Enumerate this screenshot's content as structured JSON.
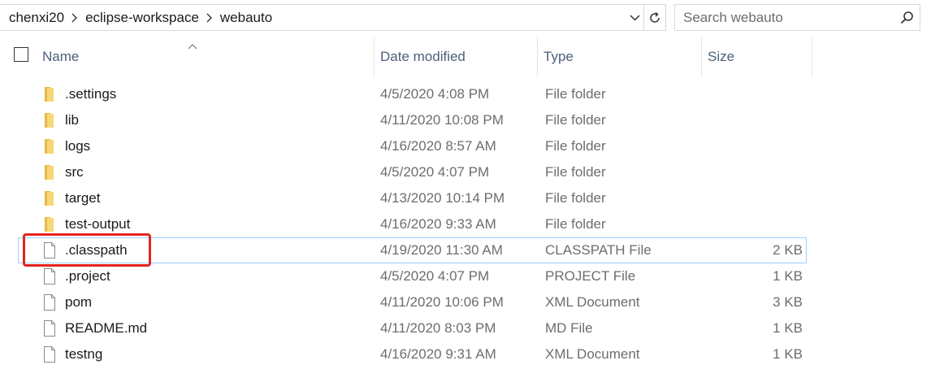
{
  "address": {
    "crumbs": [
      "chenxi20",
      "eclipse-workspace",
      "webauto"
    ]
  },
  "search": {
    "placeholder": "Search webauto"
  },
  "columns": {
    "name": "Name",
    "date": "Date modified",
    "type": "Type",
    "size": "Size"
  },
  "files": [
    {
      "name": ".settings",
      "date": "4/5/2020 4:08 PM",
      "type": "File folder",
      "size": "",
      "kind": "folder"
    },
    {
      "name": "lib",
      "date": "4/11/2020 10:08 PM",
      "type": "File folder",
      "size": "",
      "kind": "folder"
    },
    {
      "name": "logs",
      "date": "4/16/2020 8:57 AM",
      "type": "File folder",
      "size": "",
      "kind": "folder"
    },
    {
      "name": "src",
      "date": "4/5/2020 4:07 PM",
      "type": "File folder",
      "size": "",
      "kind": "folder"
    },
    {
      "name": "target",
      "date": "4/13/2020 10:14 PM",
      "type": "File folder",
      "size": "",
      "kind": "folder"
    },
    {
      "name": "test-output",
      "date": "4/16/2020 9:33 AM",
      "type": "File folder",
      "size": "",
      "kind": "folder"
    },
    {
      "name": ".classpath",
      "date": "4/19/2020 11:30 AM",
      "type": "CLASSPATH File",
      "size": "2 KB",
      "kind": "file",
      "selected": true
    },
    {
      "name": ".project",
      "date": "4/5/2020 4:07 PM",
      "type": "PROJECT File",
      "size": "1 KB",
      "kind": "file"
    },
    {
      "name": "pom",
      "date": "4/11/2020 10:06 PM",
      "type": "XML Document",
      "size": "3 KB",
      "kind": "file"
    },
    {
      "name": "README.md",
      "date": "4/11/2020 8:03 PM",
      "type": "MD File",
      "size": "1 KB",
      "kind": "file"
    },
    {
      "name": "testng",
      "date": "4/16/2020 9:31 AM",
      "type": "XML Document",
      "size": "1 KB",
      "kind": "file"
    }
  ],
  "colors": {
    "folder": "#f8d775",
    "header_text": "#4c607a",
    "selection_border": "#99d1ff",
    "annotation": "#e32420"
  }
}
